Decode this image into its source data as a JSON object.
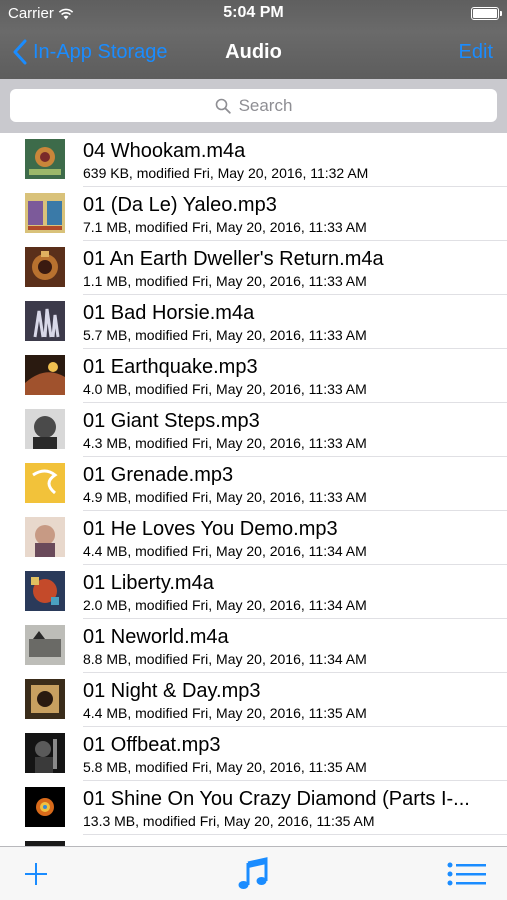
{
  "status": {
    "carrier": "Carrier",
    "time": "5:04 PM"
  },
  "nav": {
    "back_label": "In-App Storage",
    "title": "Audio",
    "edit_label": "Edit"
  },
  "search": {
    "placeholder": "Search"
  },
  "files": [
    {
      "name": " 04 Whookam.m4a",
      "meta": "639 KB, modified Fri, May 20, 2016, 11:32 AM",
      "art": "art-1"
    },
    {
      "name": "01 (Da Le) Yaleo.mp3",
      "meta": "7.1 MB, modified Fri, May 20, 2016, 11:33 AM",
      "art": "art-2"
    },
    {
      "name": "01 An Earth Dweller's Return.m4a",
      "meta": "1.1 MB, modified Fri, May 20, 2016, 11:33 AM",
      "art": "art-3"
    },
    {
      "name": "01 Bad Horsie.m4a",
      "meta": "5.7 MB, modified Fri, May 20, 2016, 11:33 AM",
      "art": "art-4"
    },
    {
      "name": "01 Earthquake.mp3",
      "meta": "4.0 MB, modified Fri, May 20, 2016, 11:33 AM",
      "art": "art-5"
    },
    {
      "name": "01 Giant Steps.mp3",
      "meta": "4.3 MB, modified Fri, May 20, 2016, 11:33 AM",
      "art": "art-6"
    },
    {
      "name": "01 Grenade.mp3",
      "meta": "4.9 MB, modified Fri, May 20, 2016, 11:33 AM",
      "art": "art-7"
    },
    {
      "name": "01 He Loves You Demo.mp3",
      "meta": "4.4 MB, modified Fri, May 20, 2016, 11:34 AM",
      "art": "art-8"
    },
    {
      "name": "01 Liberty.m4a",
      "meta": "2.0 MB, modified Fri, May 20, 2016, 11:34 AM",
      "art": "art-9"
    },
    {
      "name": "01 Neworld.m4a",
      "meta": "8.8 MB, modified Fri, May 20, 2016, 11:34 AM",
      "art": "art-10"
    },
    {
      "name": "01 Night & Day.mp3",
      "meta": "4.4 MB, modified Fri, May 20, 2016, 11:35 AM",
      "art": "art-11"
    },
    {
      "name": "01 Offbeat.mp3",
      "meta": "5.8 MB, modified Fri, May 20, 2016, 11:35 AM",
      "art": "art-12"
    },
    {
      "name": "01 Shine On You Crazy Diamond (Parts I-...",
      "meta": "13.3 MB, modified Fri, May 20, 2016, 11:35 AM",
      "art": "art-13"
    }
  ],
  "toolbar": {
    "add_icon": "plus-icon",
    "music_icon": "music-note-icon",
    "list_icon": "list-icon"
  },
  "colors": {
    "accent": "#1a8cff",
    "nav_bg": "#636363",
    "search_bg": "#c9c9ce"
  }
}
